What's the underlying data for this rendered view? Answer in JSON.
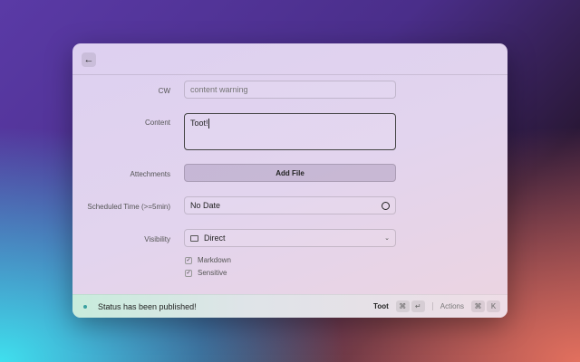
{
  "header": {
    "back_icon": "arrow-left-icon"
  },
  "form": {
    "cw": {
      "label": "CW",
      "placeholder": "content warning",
      "value": ""
    },
    "content": {
      "label": "Content",
      "value": "Toot!"
    },
    "attachments": {
      "label": "Attechments",
      "button": "Add File"
    },
    "scheduled": {
      "label": "Scheduled Time (>=5min)",
      "value": "No Date",
      "icon": "clock-icon"
    },
    "visibility": {
      "label": "Visibility",
      "value": "Direct",
      "icon": "envelope-icon"
    },
    "checkboxes": [
      {
        "label": "Markdown",
        "checked": true
      },
      {
        "label": "Sensitive",
        "checked": true
      }
    ]
  },
  "footer": {
    "status": "Status has been published!",
    "status_color": "#3aa0a0",
    "primary_action": "Toot",
    "primary_keys": [
      "⌘",
      "↵"
    ],
    "actions_label": "Actions",
    "actions_keys": [
      "⌘",
      "K"
    ]
  }
}
